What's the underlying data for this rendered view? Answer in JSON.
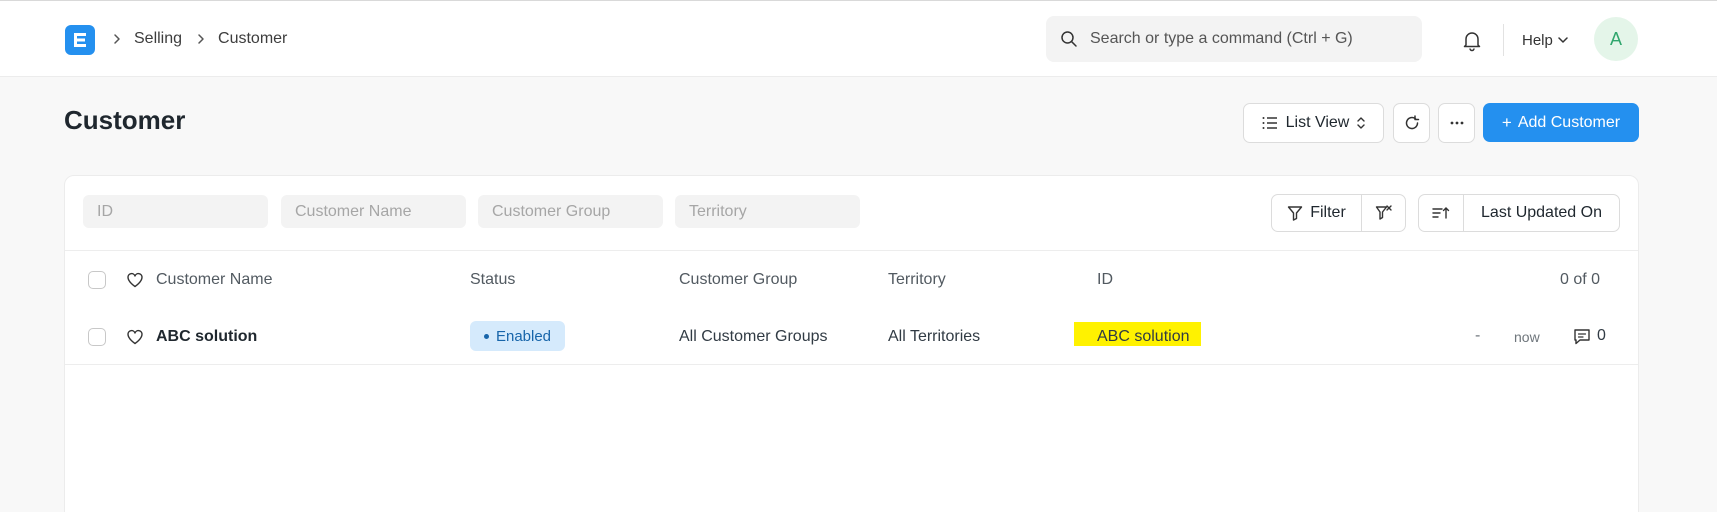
{
  "navbar": {
    "logo_letter": "E",
    "breadcrumbs": [
      "Selling",
      "Customer"
    ],
    "search_placeholder": "Search or type a command (Ctrl + G)",
    "help_label": "Help",
    "avatar_initial": "A"
  },
  "page": {
    "title": "Customer",
    "list_view_label": "List View",
    "add_button_label": "Add Customer",
    "add_button_prefix": "+",
    "accent_color": "#2490ef"
  },
  "filters": {
    "placeholders": [
      "ID",
      "Customer Name",
      "Customer Group",
      "Territory"
    ],
    "filter_label": "Filter",
    "sort_label": "Last Updated On"
  },
  "table": {
    "headers": {
      "customer_name": "Customer Name",
      "status": "Status",
      "customer_group": "Customer Group",
      "territory": "Territory",
      "id": "ID",
      "count": "0 of 0"
    },
    "rows": [
      {
        "customer_name": "ABC solution",
        "status": "Enabled",
        "customer_group": "All Customer Groups",
        "territory": "All Territories",
        "id": "ABC solution",
        "dash": "-",
        "modified": "now",
        "comments": "0"
      }
    ]
  }
}
